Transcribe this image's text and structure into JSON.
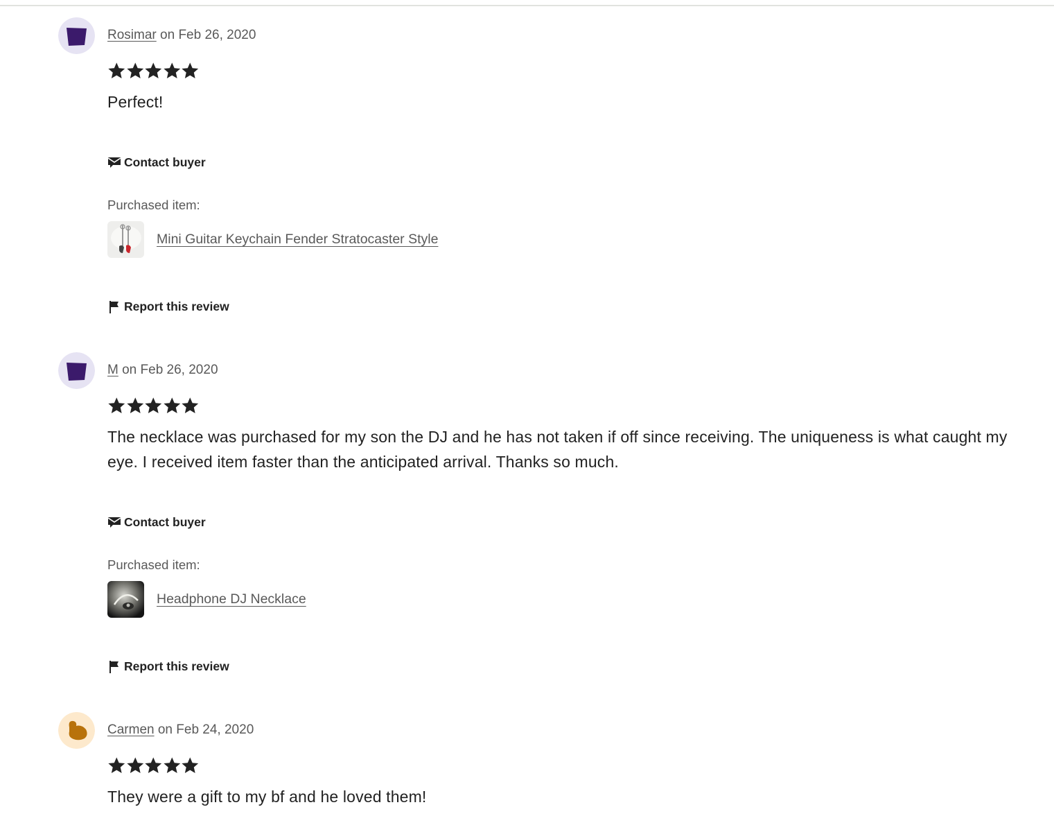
{
  "labels": {
    "on": "on",
    "contact_buyer": "Contact buyer",
    "purchased_item": "Purchased item:",
    "report_review": "Report this review"
  },
  "colors": {
    "avatar_purple_bg": "#e6e3f3",
    "avatar_purple_fg": "#3b1a6b",
    "avatar_orange_bg": "#fde9cc",
    "avatar_orange_fg": "#b8720b",
    "star": "#222222",
    "meta_text": "#595959"
  },
  "reviews": [
    {
      "reviewer": "Rosimar",
      "date": "Feb 26, 2020",
      "rating": 5,
      "avatar_icon": "purple-shape-avatar-icon",
      "text": "Perfect!",
      "item_title": "Mini Guitar Keychain Fender Stratocaster Style"
    },
    {
      "reviewer": "M",
      "date": "Feb 26, 2020",
      "rating": 5,
      "avatar_icon": "purple-shape-avatar-icon",
      "text": "The necklace was purchased for my son the DJ and he has not taken if off since receiving. The uniqueness is what caught my eye. I received item faster than the anticipated arrival. Thanks so much.",
      "item_title": "Headphone DJ Necklace"
    },
    {
      "reviewer": "Carmen",
      "date": "Feb 24, 2020",
      "rating": 5,
      "avatar_icon": "orange-blob-avatar-icon",
      "text": "They were a gift to my bf and he loved them!"
    }
  ]
}
